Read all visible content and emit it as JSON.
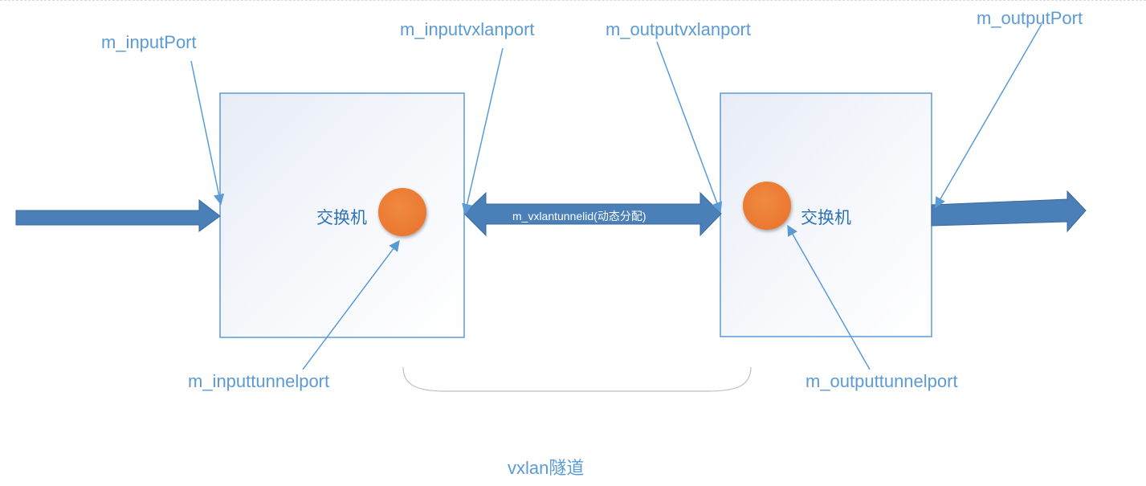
{
  "labels": {
    "input_port": "m_inputPort",
    "input_vxlan_port": "m_inputvxlanport",
    "output_vxlan_port": "m_outputvxlanport",
    "output_port": "m_outputPort",
    "input_tunnel_port": "m_inputtunnelport",
    "output_tunnel_port": "m_outputtunnelport",
    "tunnel_id": "m_vxlantunnelid(动态分配)",
    "tunnel_name": "vxlan隧道"
  },
  "switches": [
    {
      "label": "交换机"
    },
    {
      "label": "交换机"
    }
  ],
  "colors": {
    "label_text": "#5b9bd5",
    "switch_text": "#2e74b5",
    "pointer_line": "#5b9bd5",
    "arrow_fill": "#4a7fb8",
    "arrow_stroke": "#3a6a9e",
    "box_border": "#5b9bd5",
    "port_circle": "#ed7d31",
    "brace": "#bfbfbf"
  }
}
